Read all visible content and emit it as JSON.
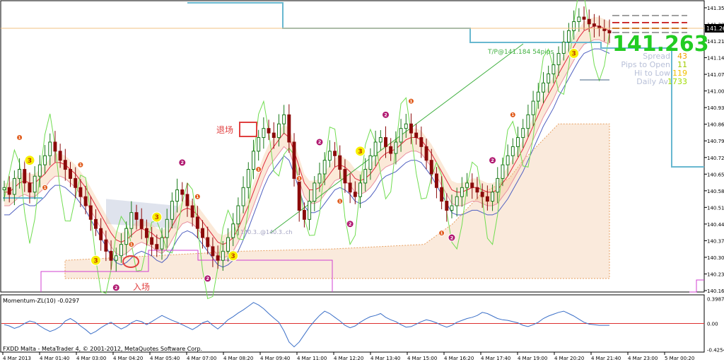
{
  "chart_data": {
    "type": "line",
    "title": "",
    "main_panel": {
      "price_ylim": [
        140.13,
        141.38
      ],
      "price_ticks": [
        "141.355",
        "141.285",
        "141.215",
        "141.145",
        "141.075",
        "141.005",
        "140.935",
        "140.865",
        "140.795",
        "140.725",
        "140.655",
        "140.585",
        "140.515",
        "140.445",
        "140.375",
        "140.305",
        "140.235",
        "140.165"
      ],
      "current_price_label": "141.263",
      "current_price": 141.263,
      "big_price": "141.263",
      "tp_label": "T/P@141.184",
      "tp_label_suffix": "54pips",
      "ladder_label": "140.3..@140.3..ch",
      "annotations": {
        "exit": "退场",
        "entry": "入场"
      },
      "info": [
        {
          "label": "Spread",
          "value": "43"
        },
        {
          "label": "Pips to Open",
          "value": "11"
        },
        {
          "label": "Hi to Low",
          "value": "119"
        },
        {
          "label": "Daily Av",
          "value": "1733"
        }
      ],
      "close_series": [
        140.58,
        140.55,
        140.62,
        140.66,
        140.6,
        140.56,
        140.63,
        140.68,
        140.72,
        140.78,
        140.74,
        140.7,
        140.66,
        140.62,
        140.58,
        140.54,
        140.5,
        140.44,
        140.4,
        140.35,
        140.3,
        140.26,
        140.28,
        140.33,
        140.4,
        140.47,
        140.44,
        140.4,
        140.36,
        140.33,
        140.31,
        140.36,
        140.44,
        140.52,
        140.57,
        140.55,
        140.5,
        140.45,
        140.4,
        140.36,
        140.32,
        140.28,
        140.26,
        140.3,
        140.36,
        140.42,
        140.5,
        140.58,
        140.66,
        140.74,
        140.8,
        140.84,
        140.82,
        140.8,
        140.86,
        140.9,
        140.78,
        140.62,
        140.48,
        140.44,
        140.52,
        140.6,
        140.64,
        140.7,
        140.74,
        140.72,
        140.66,
        140.6,
        140.56,
        140.54,
        140.6,
        140.66,
        140.72,
        140.78,
        140.8,
        140.76,
        140.73,
        140.78,
        140.84,
        140.86,
        140.82,
        140.8,
        140.76,
        140.7,
        140.64,
        140.58,
        140.52,
        140.48,
        140.5,
        140.54,
        140.58,
        140.6,
        140.58,
        140.56,
        140.54,
        140.52,
        140.56,
        140.62,
        140.68,
        140.72,
        140.76,
        140.8,
        140.84,
        140.9,
        140.96,
        141.0,
        141.04,
        141.08,
        141.12,
        141.17,
        141.22,
        141.27,
        141.31,
        141.33,
        141.32,
        141.3,
        141.29,
        141.28,
        141.27,
        141.26
      ],
      "series": [
        {
          "name": "",
          "values": [
            140.56,
            140.56,
            140.58,
            140.6,
            140.61,
            140.6,
            140.6,
            140.62,
            140.64,
            140.67,
            140.69,
            140.69,
            140.68,
            140.66,
            140.64,
            140.61,
            140.58,
            140.54,
            140.5,
            140.46,
            140.42,
            140.38,
            140.35,
            140.34,
            140.35,
            140.37,
            140.39,
            140.4,
            140.39,
            140.38,
            140.36,
            140.35,
            140.37,
            140.41,
            140.45,
            140.48,
            140.49,
            140.48,
            140.46,
            140.43,
            140.4,
            140.37,
            140.34,
            140.33,
            140.34,
            140.36,
            140.4,
            140.45,
            140.5,
            140.56,
            140.62,
            140.68,
            140.73,
            140.76,
            140.79,
            140.82,
            140.8,
            140.74,
            140.67,
            140.6,
            140.57,
            140.57,
            140.58,
            140.61,
            140.64,
            140.67,
            140.68,
            140.67,
            140.65,
            140.62,
            140.61,
            140.62,
            140.64,
            140.67,
            140.71,
            140.73,
            140.74,
            140.75,
            140.77,
            140.79,
            140.8,
            140.8,
            140.79,
            140.76,
            140.73,
            140.69,
            140.65,
            140.61,
            140.57,
            140.56,
            140.56,
            140.57,
            140.58,
            140.58,
            140.57,
            140.56,
            140.56,
            140.57,
            140.6,
            140.63,
            140.67,
            140.71,
            140.75,
            140.8,
            140.85,
            140.9,
            140.95,
            140.99,
            141.03,
            141.08,
            141.12,
            141.16,
            141.2,
            141.24,
            141.27,
            141.28,
            141.29,
            141.29,
            141.28,
            141.27
          ]
        }
      ],
      "trade_marker_labels": [
        "3",
        "3",
        "3",
        "3",
        "3",
        "3",
        "2",
        "2",
        "2",
        "2",
        "2",
        "2",
        "2",
        "2",
        "1",
        "1",
        "1",
        "1",
        "1",
        "1",
        "1",
        "1",
        "1",
        "1",
        "1"
      ]
    },
    "momentum_panel": {
      "title": "Momentum-ZL(10) -0.0297",
      "ylim": [
        -0.43,
        0.43
      ],
      "ticks": [
        "0.3987",
        "0.00",
        "-0.4254"
      ],
      "values": [
        -0.02,
        -0.04,
        -0.08,
        -0.05,
        0.0,
        0.04,
        0.02,
        -0.04,
        -0.09,
        -0.13,
        -0.1,
        -0.05,
        0.04,
        0.08,
        0.03,
        -0.04,
        -0.1,
        -0.17,
        -0.13,
        -0.07,
        -0.02,
        0.02,
        -0.04,
        -0.09,
        -0.05,
        0.01,
        0.05,
        0.03,
        -0.02,
        0.03,
        0.08,
        0.13,
        0.09,
        0.05,
        0.02,
        -0.02,
        -0.06,
        -0.1,
        -0.05,
        0.01,
        0.04,
        -0.03,
        -0.09,
        -0.02,
        0.06,
        0.11,
        0.17,
        0.22,
        0.28,
        0.34,
        0.3,
        0.24,
        0.16,
        0.09,
        0.02,
        -0.12,
        -0.3,
        -0.38,
        -0.3,
        -0.18,
        -0.06,
        0.04,
        0.13,
        0.2,
        0.16,
        0.1,
        0.04,
        -0.03,
        -0.07,
        -0.04,
        0.02,
        0.07,
        0.11,
        0.13,
        0.16,
        0.1,
        0.06,
        0.03,
        -0.02,
        -0.06,
        -0.05,
        -0.01,
        0.03,
        0.06,
        0.04,
        0.01,
        -0.03,
        -0.06,
        -0.03,
        0.02,
        0.05,
        0.08,
        0.1,
        0.13,
        0.18,
        0.16,
        0.12,
        0.08,
        0.06,
        0.05,
        0.03,
        0.01,
        -0.03,
        -0.05,
        -0.02,
        0.02,
        0.08,
        0.12,
        0.15,
        0.18,
        0.2,
        0.16,
        0.12,
        0.07,
        0.02,
        -0.01,
        -0.02,
        -0.03,
        -0.03,
        -0.03
      ]
    },
    "x_ticks": [
      "4 Mar 2013",
      "4 Mar 01:40",
      "4 Mar 03:00",
      "4 Mar 04:20",
      "4 Mar 05:40",
      "4 Mar 07:00",
      "4 Mar 08:20",
      "4 Mar 09:40",
      "4 Mar 11:00",
      "4 Mar 12:20",
      "4 Mar 13:40",
      "4 Mar 15:00",
      "4 Mar 16:20",
      "4 Mar 17:40",
      "4 Mar 19:00",
      "4 Mar 20:20",
      "4 Mar 21:40",
      "4 Mar 23:00",
      "5 Mar 00:20"
    ],
    "footer": "FXDD Malta - MetaTrader 4, © 2001-2012, MetaQuotes Software Corp.",
    "colors": {
      "candle_up": "#1a7a1a",
      "candle_down": "#8b0a0a",
      "line_red": "#e0283c",
      "line_pink": "#e890a0",
      "line_green": "#70dd50",
      "line_blue": "#5060c0",
      "line_teal": "#68b8d0",
      "line_orange": "#e8a040",
      "line_magenta": "#d040d0",
      "zone_orange": "#e8a060",
      "zone_blue": "#8090b8",
      "marker_yellow": "#f8f000",
      "marker_purple": "#b01870",
      "marker_orange": "#e05a1a",
      "big_price_green": "#22cc22",
      "info_label": "#b8c0d8",
      "info_value_a": "#f0a000",
      "info_value_b": "#a0cc00",
      "info_value_c": "#f0c000",
      "info_value_d": "#a0dd00",
      "annotation_red": "#e04040",
      "momentum_line": "#3c70c8",
      "momentum_zero": "#dd3030"
    }
  }
}
